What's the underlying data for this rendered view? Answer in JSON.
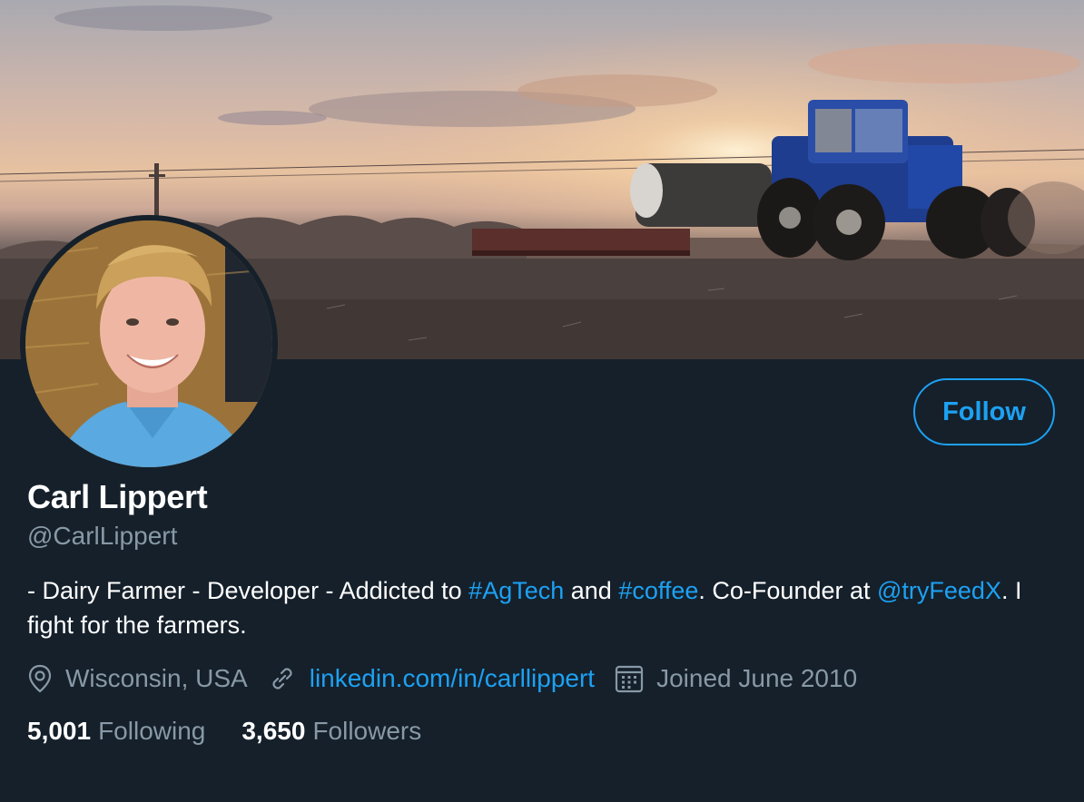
{
  "banner": {
    "description_icon": "banner-image"
  },
  "profile": {
    "display_name": "Carl Lippert",
    "handle": "@CarlLippert",
    "follow_label": "Follow",
    "bio": {
      "part1": "- Dairy Farmer - Developer - Addicted to ",
      "hashtag1": "#AgTech",
      "part2": " and ",
      "hashtag2": "#coffee",
      "part3": ". Co-Founder at ",
      "mention": "@tryFeedX",
      "part4": ". I fight for the farmers."
    },
    "location": "Wisconsin, USA",
    "website": "linkedin.com/in/carllippert",
    "joined": "Joined June 2010",
    "following_count": "5,001",
    "following_label": "Following",
    "followers_count": "3,650",
    "followers_label": "Followers"
  },
  "colors": {
    "background": "#15202b",
    "accent": "#1da1f2",
    "secondary_text": "#8899a6",
    "primary_text": "#ffffff"
  },
  "icons": {
    "location": "location-pin-icon",
    "link": "link-icon",
    "calendar": "calendar-icon"
  }
}
